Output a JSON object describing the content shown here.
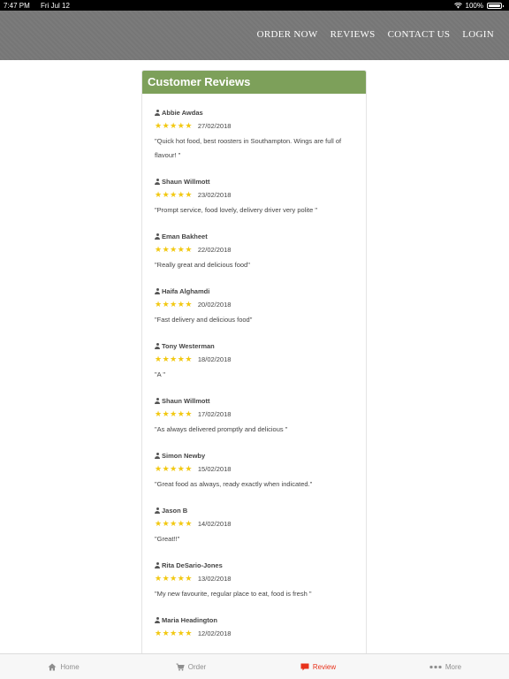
{
  "status_bar": {
    "time": "7:47 PM",
    "date": "Fri Jul 12",
    "battery": "100%",
    "battery_level": 1.0
  },
  "nav": {
    "items": [
      "ORDER NOW",
      "REVIEWS",
      "CONTACT US",
      "LOGIN"
    ]
  },
  "panel": {
    "title": "Customer Reviews"
  },
  "reviews": [
    {
      "name": "Abbie Awdas",
      "date": "27/02/2018",
      "rating": 5,
      "text": "\"Quick hot food, best roosters in Southampton. Wings are full of flavour! \""
    },
    {
      "name": "Shaun Willmott",
      "date": "23/02/2018",
      "rating": 5,
      "text": "\"Prompt service, food lovely, delivery driver very polite \""
    },
    {
      "name": "Eman Bakheet",
      "date": "22/02/2018",
      "rating": 5,
      "text": "\"Really great and delicious food\""
    },
    {
      "name": "Haifa Alghamdi",
      "date": "20/02/2018",
      "rating": 5,
      "text": "\"Fast delivery and delicious food\""
    },
    {
      "name": "Tony Westerman",
      "date": "18/02/2018",
      "rating": 5,
      "text": "\"A \""
    },
    {
      "name": "Shaun Willmott",
      "date": "17/02/2018",
      "rating": 5,
      "text": "\"As always delivered promptly and delicious \""
    },
    {
      "name": "Simon Newby",
      "date": "15/02/2018",
      "rating": 5,
      "text": "\"Great food as always, ready exactly when indicated.\""
    },
    {
      "name": "Jason B",
      "date": "14/02/2018",
      "rating": 5,
      "text": "\"Great!!\""
    },
    {
      "name": "Rita DeSario-Jones",
      "date": "13/02/2018",
      "rating": 5,
      "text": "\"My new favourite, regular place to eat, food is fresh \""
    },
    {
      "name": "Maria Headington",
      "date": "12/02/2018",
      "rating": 5,
      "text": ""
    }
  ],
  "tab_bar": {
    "tabs": [
      {
        "label": "Home",
        "icon": "home-icon",
        "active": false
      },
      {
        "label": "Order",
        "icon": "cart-icon",
        "active": false
      },
      {
        "label": "Review",
        "icon": "review-icon",
        "active": true
      },
      {
        "label": "More",
        "icon": "more-icon",
        "active": false
      }
    ]
  },
  "colors": {
    "accent": "#7da05a",
    "star": "#f2c811",
    "active_tab": "#e8321b",
    "header": "#787878"
  }
}
